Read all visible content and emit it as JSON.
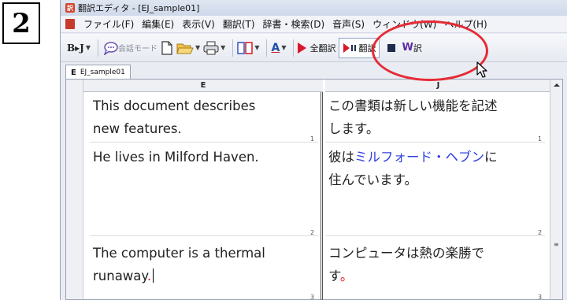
{
  "step": {
    "number": "2"
  },
  "window": {
    "title": "翻訳エディタ - [EJ_sample01]"
  },
  "menu": {
    "items": [
      "ファイル(F)",
      "編集(E)",
      "表示(V)",
      "翻訳(T)",
      "辞書・検索(D)",
      "音声(S)",
      "ウィンドウ(W)",
      "ヘルプ(H)"
    ]
  },
  "toolbar": {
    "bj_label": "B▸J",
    "conversation_mode": "会話モード",
    "translate_all": "全翻訳",
    "translate": "翻訳",
    "stop_icon": "stop-square-icon"
  },
  "tab": {
    "mark": "E",
    "label": "EJ_sample01"
  },
  "columns": {
    "left": "E",
    "right": "J"
  },
  "segments": [
    {
      "number": "1",
      "source": [
        "This document describes",
        "new features."
      ],
      "target": [
        "この書類は新しい機能を記述",
        "します。"
      ]
    },
    {
      "number": "2",
      "source": [
        "He lives in Milford Haven."
      ],
      "target_pre": "彼は",
      "target_link": "ミルフォード・ヘブン",
      "target_post": "に",
      "target_line2": "住んでいます。"
    },
    {
      "number": "3",
      "source_line1": "The computer is a thermal",
      "source_line2": "runaway",
      "source_punct": ".",
      "target_line1": "コンピュータは熱の楽勝で",
      "target_line2": "す",
      "target_punct": "。"
    }
  ],
  "colors": {
    "highlight_circle": "#e52b36",
    "link": "#2e3fe0",
    "error": "#e01b1b"
  }
}
